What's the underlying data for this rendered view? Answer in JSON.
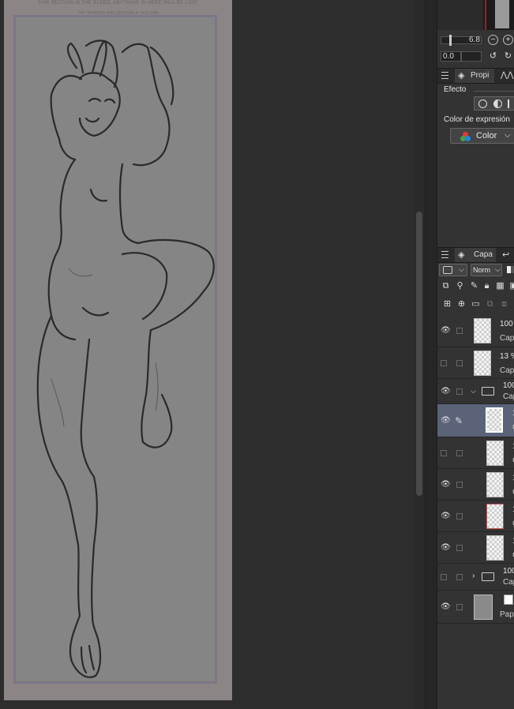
{
  "canvas": {
    "bleed_notice": "THIS SECTION IS THE BLEED, ANYTHING IN HERE WILL BE LOST",
    "bleed_subnotice": "TRY TO AVOID THIS SECTION, IF YOU CAN"
  },
  "navigator": {
    "zoom": "6.8",
    "rotation": "0.0"
  },
  "properties": {
    "tab_label": "Propi",
    "effect_label": "Efecto",
    "expression_color_label": "Color de expresión",
    "expression_color_value": "Color"
  },
  "layers_panel": {
    "tab_label": "Capa",
    "blend_mode": "Norm",
    "layers": [
      {
        "opacity": "100",
        "name": "Capa",
        "visible": true
      },
      {
        "opacity": "13 %",
        "name": "Capa",
        "visible": false
      },
      {
        "opacity": "100",
        "name": "Cap",
        "visible": true,
        "type": "folder-open"
      },
      {
        "opacity": "1",
        "name": "C",
        "visible": true,
        "selected": true
      },
      {
        "opacity": "1",
        "name": "C",
        "visible": false
      },
      {
        "opacity": "1",
        "name": "C",
        "visible": true
      },
      {
        "opacity": "1",
        "name": "C",
        "visible": true
      },
      {
        "opacity": "1",
        "name": "C",
        "visible": true
      },
      {
        "opacity": "100",
        "name": "Cap",
        "visible": false,
        "type": "folder-closed"
      },
      {
        "opacity": "",
        "name": "Pap",
        "visible": true,
        "type": "paper"
      }
    ]
  },
  "colors": {
    "selected_layer": "#5a6378",
    "panel_bg": "#333333",
    "canvas_bg": "#2d2d2d"
  }
}
